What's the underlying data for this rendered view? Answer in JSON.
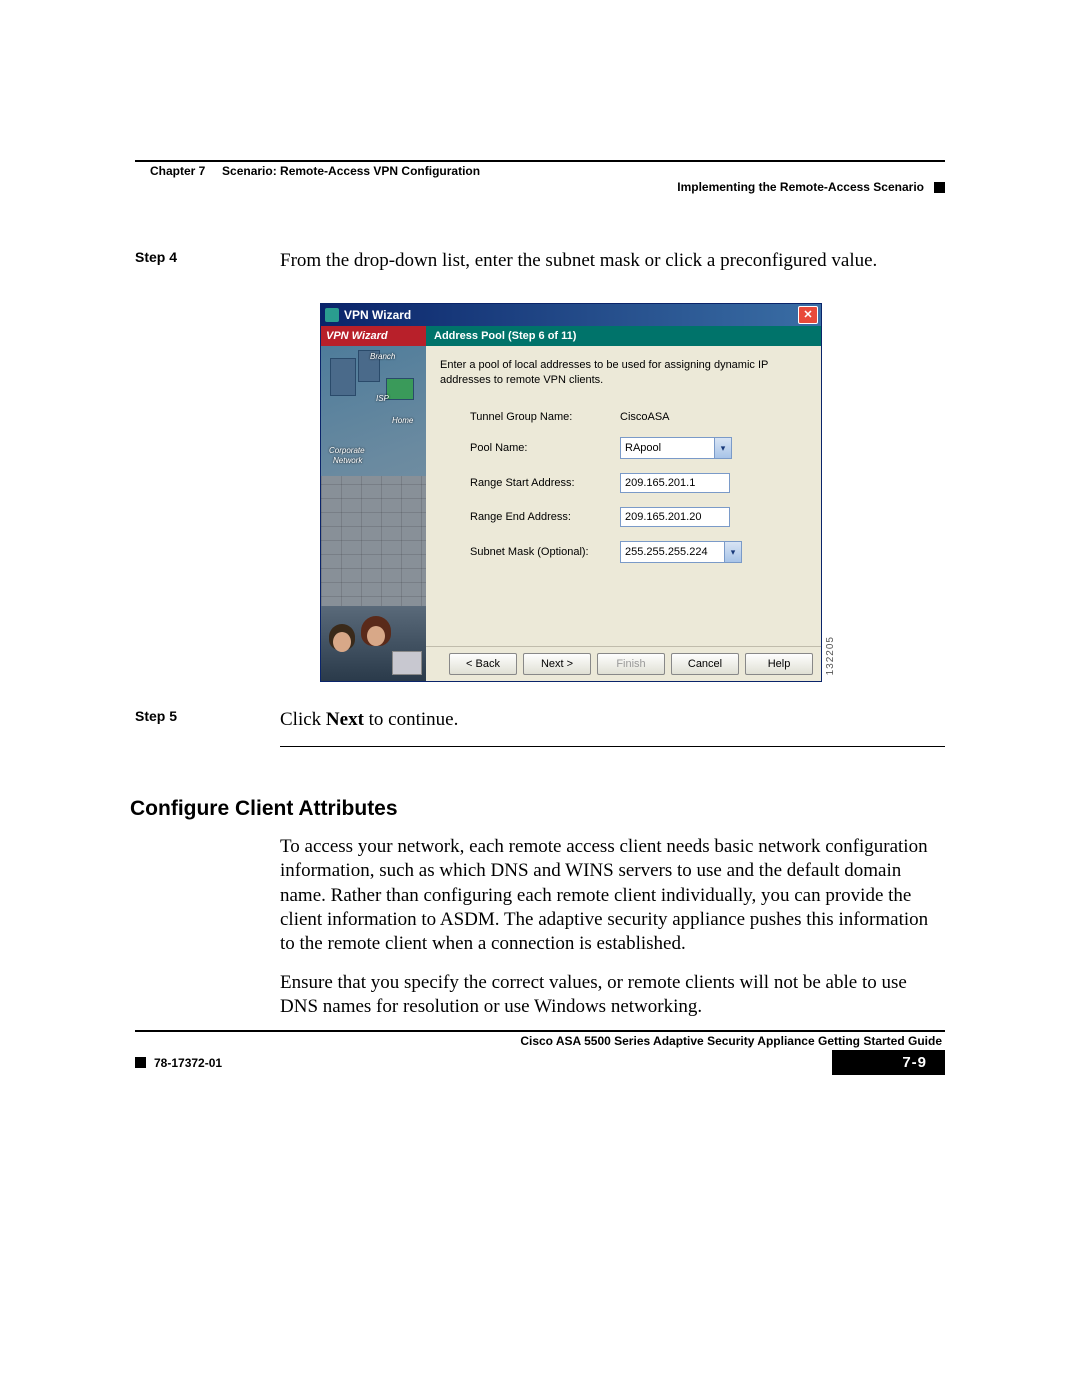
{
  "header": {
    "chapter": "Chapter 7",
    "chapter_title": "Scenario: Remote-Access VPN Configuration",
    "section_right": "Implementing the Remote-Access Scenario"
  },
  "steps": {
    "step4_label": "Step 4",
    "step4_text": "From the drop-down list, enter the subnet mask or click a preconfigured value.",
    "step5_label": "Step 5",
    "step5_pre": "Click ",
    "step5_bold": "Next",
    "step5_post": " to continue."
  },
  "wizard": {
    "window_title": "VPN Wizard",
    "banner": "VPN Wizard",
    "step_header": "Address Pool   (Step 6 of 11)",
    "description": "Enter a pool of local addresses to be used for assigning dynamic IP addresses to remote VPN clients.",
    "fields": {
      "tunnel_label": "Tunnel Group Name:",
      "tunnel_value": "CiscoASA",
      "pool_label": "Pool Name:",
      "pool_value": "RApool",
      "start_label": "Range Start Address:",
      "start_value": "209.165.201.1",
      "end_label": "Range End Address:",
      "end_value": "209.165.201.20",
      "mask_label": "Subnet Mask (Optional):",
      "mask_value": "255.255.255.224"
    },
    "side_labels": {
      "branch": "Branch",
      "isp": "ISP",
      "home": "Home",
      "corp1": "Corporate",
      "corp2": "Network"
    },
    "buttons": {
      "back": "< Back",
      "next": "Next >",
      "finish": "Finish",
      "cancel": "Cancel",
      "help": "Help"
    },
    "image_id": "132205"
  },
  "section": {
    "heading": "Configure Client Attributes",
    "para1": "To access your network, each remote access client needs basic network configuration information, such as which DNS and WINS servers to use and the default domain name. Rather than configuring each remote client individually, you can provide the client information to ASDM. The adaptive security appliance pushes this information to the remote client when a connection is established.",
    "para2": "Ensure that you specify the correct values, or remote clients will not be able to use DNS names for resolution or use Windows networking."
  },
  "footer": {
    "guide_title": "Cisco ASA 5500 Series Adaptive Security Appliance Getting Started Guide",
    "doc_number": "78-17372-01",
    "page_number": "7-9"
  }
}
